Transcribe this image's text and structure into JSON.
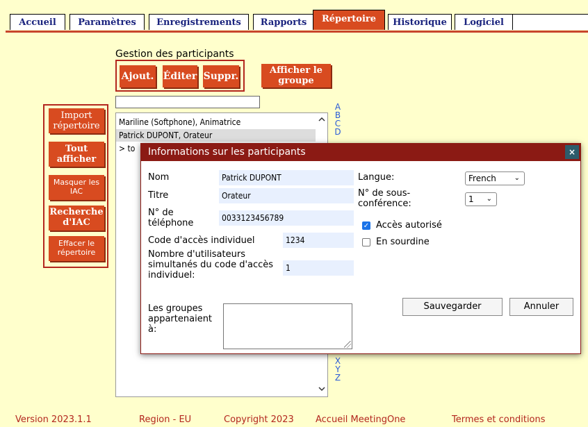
{
  "tabs": [
    {
      "label": "Accueil"
    },
    {
      "label": "Paramètres"
    },
    {
      "label": "Enregistrements"
    },
    {
      "label": "Rapports"
    },
    {
      "label": "Répertoire"
    },
    {
      "label": "Historique"
    },
    {
      "label": "Logiciel"
    }
  ],
  "active_tab": "Répertoire",
  "participants": {
    "heading": "Gestion des participants",
    "add_label": "Ajout.",
    "edit_label": "Éditer",
    "delete_label": "Suppr.",
    "show_group_label": "Afficher le groupe",
    "search_value": "",
    "list": [
      {
        "label": "Mariline (Softphone), Animatrice",
        "selected": false
      },
      {
        "label": "Patrick DUPONT, Orateur",
        "selected": true
      },
      {
        "label": "> to",
        "selected": false
      }
    ],
    "alphabet_top": [
      "A",
      "B",
      "C",
      "D"
    ],
    "alphabet_bottom": [
      "X",
      "Y",
      "Z"
    ]
  },
  "sidebar": {
    "import_label": "Import répertoire",
    "show_all_label": "Tout afficher",
    "hide_iac_label": "Masquer les IAC",
    "search_iac_label": "Recherche d'IAC",
    "clear_label": "Effacer le répertoire"
  },
  "dialog": {
    "title": "Informations sur les participants",
    "close": "×",
    "name_label": "Nom",
    "name_value": "Patrick DUPONT",
    "title_label": "Titre",
    "title_value": "Orateur",
    "phone_label": "N° de téléphone",
    "phone_value": "0033123456789",
    "code_label": "Code d'accès individuel",
    "code_value": "1234",
    "users_label": "Nombre d'utilisateurs simultanés du code d'accès individuel:",
    "users_value": "1",
    "groups_label": "Les groupes appartenaient à:",
    "groups_value": "",
    "language_label": "Langue:",
    "language_value": "French",
    "subconf_label": "N° de sous-conférence:",
    "subconf_value": "1",
    "access_label": "Accès autorisé",
    "access_checked": true,
    "mute_label": "En sourdine",
    "mute_checked": false,
    "save_label": "Sauvegarder",
    "cancel_label": "Annuler"
  },
  "footer": {
    "version": "Version 2023.1.1",
    "region": "Region - EU",
    "copyright": "Copyright 2023",
    "home_link": "Accueil MeetingOne",
    "terms_link": "Termes et conditions"
  },
  "colors": {
    "background": "#FFFFCC",
    "accent": "#D84B20",
    "dialog_title": "#8B1A14",
    "tab_text": "#1a237e",
    "link": "#2a5bd7"
  }
}
